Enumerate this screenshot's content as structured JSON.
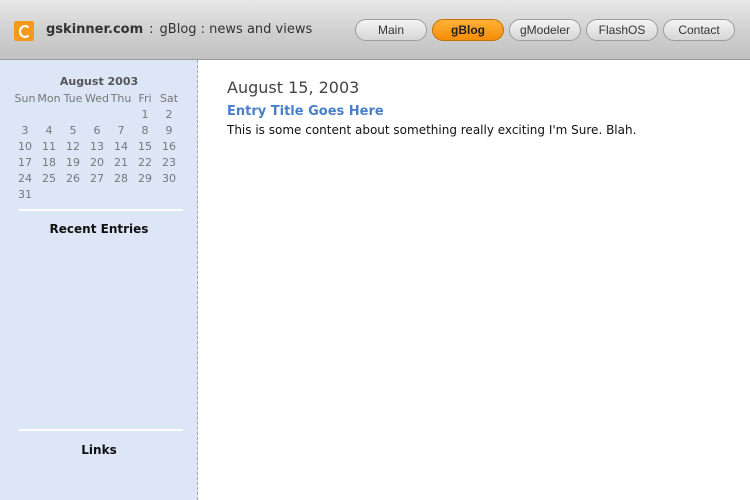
{
  "header": {
    "site_name": "gskinner.com",
    "separator": ":",
    "tagline": "gBlog : news and views"
  },
  "nav": [
    {
      "label": "Main",
      "active": false
    },
    {
      "label": "gBlog",
      "active": true
    },
    {
      "label": "gModeler",
      "active": false
    },
    {
      "label": "FlashOS",
      "active": false
    },
    {
      "label": "Contact",
      "active": false
    }
  ],
  "calendar": {
    "title": "August 2003",
    "weekdays": [
      "Sun",
      "Mon",
      "Tue",
      "Wed",
      "Thu",
      "Fri",
      "Sat"
    ],
    "weeks": [
      [
        "",
        "",
        "",
        "",
        "",
        "1",
        "2"
      ],
      [
        "3",
        "4",
        "5",
        "6",
        "7",
        "8",
        "9"
      ],
      [
        "10",
        "11",
        "12",
        "13",
        "14",
        "15",
        "16"
      ],
      [
        "17",
        "18",
        "19",
        "20",
        "21",
        "22",
        "23"
      ],
      [
        "24",
        "25",
        "26",
        "27",
        "28",
        "29",
        "30"
      ],
      [
        "31",
        "",
        "",
        "",
        "",
        "",
        ""
      ]
    ]
  },
  "sidebar": {
    "recent_entries_label": "Recent Entries",
    "links_label": "Links"
  },
  "entry": {
    "date": "August 15, 2003",
    "title": "Entry Title Goes Here",
    "body": "This is some content about something really exciting I'm Sure. Blah."
  },
  "colors": {
    "accent": "#f39a1d",
    "sidebar_bg": "#dce6f7",
    "link": "#4a7fc8"
  }
}
